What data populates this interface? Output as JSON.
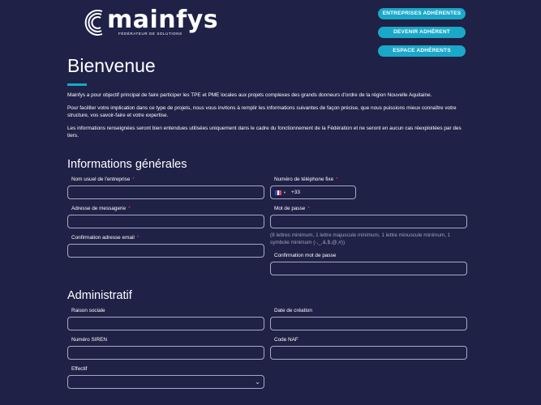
{
  "header": {
    "logo_text": "mainfys",
    "logo_tagline": "FÉDÉRATEUR DE SOLUTIONS",
    "buttons": [
      "ENTREPRISES ADHÉRENTES",
      "DEVENIR ADHÉRENT",
      "ESPACE ADHÉRENTS"
    ]
  },
  "colors": {
    "background": "#1f2147",
    "accent": "#1aa8c8",
    "required": "#e0455b"
  },
  "page_title": "Bienvenue",
  "intro": [
    "Mainfys a pour objectif principal de faire participer les TPE et PME locales aux projets complexes des grands donneurs d'ordre de la région Nouvelle Aquitaine.",
    "Pour faciliter votre implication dans ce type de projets, nous vous invitons à remplir les informations suivantes de façon précise, que nous puissions mieux connaître votre structure, vos savoir-faire et votre expertise.",
    "Les informations renseignées seront bien entendues utilisées uniquement dans le cadre du fonctionnement de la Fédération et ne seront en aucun cas réexploitées par des tiers."
  ],
  "general": {
    "title": "Informations générales",
    "company_name": {
      "label": "Nom usuel de l'entreprise",
      "required": "*"
    },
    "phone": {
      "label": "Numéro de téléphone fixe",
      "required": "*",
      "flag_icon": "france-flag-icon",
      "code": "+33"
    },
    "email": {
      "label": "Adresse de messagerie",
      "required": "*"
    },
    "password": {
      "label": "Mot de passe",
      "required": "*",
      "hint": "(8 lettres minimum, 1 lettre majuscule minimum, 1 lettre minuscule minimum, 1 symbole minimum (-,_,&,$,@,#))"
    },
    "email_confirm": {
      "label": "Confirmation adresse email",
      "required": "*"
    },
    "password_confirm": {
      "label": "Confirmation mot de passe"
    }
  },
  "admin": {
    "title": "Administratif",
    "company_legal_name": {
      "label": "Raison sociale"
    },
    "creation_date": {
      "label": "Date de création"
    },
    "siren": {
      "label": "Numéro SIREN"
    },
    "naf": {
      "label": "Code NAF"
    },
    "headcount": {
      "label": "Effectif",
      "icon": "chevron-down-icon"
    }
  }
}
